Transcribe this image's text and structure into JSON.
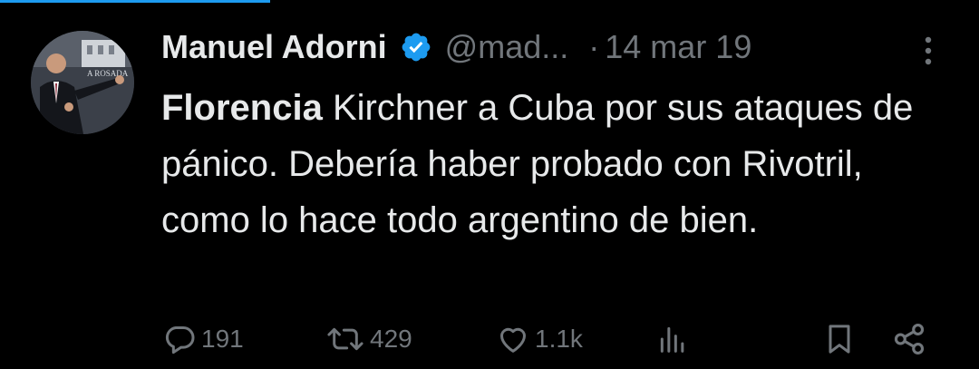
{
  "tweet": {
    "author_name": "Manuel Adorni",
    "handle": "@mad...",
    "separator": "·",
    "date": "14 mar 19",
    "text_bold": "Florencia",
    "text_rest": " Kirchner a Cuba por sus ataques de pánico. Debería haber probado con Rivotril, como lo hace todo argentino de bien."
  },
  "avatar": {
    "banner_text": "A ROSADA"
  },
  "actions": {
    "replies": "191",
    "retweets": "429",
    "likes": "1.1k"
  },
  "colors": {
    "background": "#000000",
    "text": "#e7e9ea",
    "muted": "#71767b",
    "verified": "#1d9bf0"
  },
  "icons": [
    "verified-badge-icon",
    "more-icon",
    "reply-icon",
    "retweet-icon",
    "like-icon",
    "views-icon",
    "bookmark-icon",
    "share-icon"
  ]
}
